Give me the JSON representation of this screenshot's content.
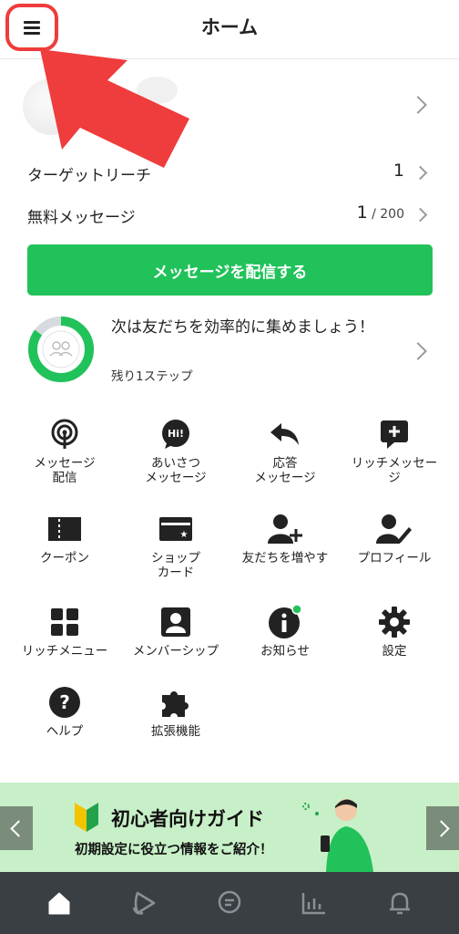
{
  "header": {
    "title": "ホーム"
  },
  "stats": [
    {
      "label": "ターゲットリーチ",
      "value": "1",
      "suffix": ""
    },
    {
      "label": "無料メッセージ",
      "value": "1",
      "suffix": " / 200"
    }
  ],
  "primary_button": "メッセージを配信する",
  "onboarding": {
    "text": "次は友だちを効率的に集めましょう！",
    "sub": "残り1ステップ",
    "progress_percent": 85
  },
  "menu": [
    {
      "label": "メッセージ\n配信",
      "icon": "broadcast-icon"
    },
    {
      "label": "あいさつ\nメッセージ",
      "icon": "hi-chat-icon"
    },
    {
      "label": "応答\nメッセージ",
      "icon": "reply-icon"
    },
    {
      "label": "リッチメッセー\nジ",
      "icon": "rich-message-icon"
    },
    {
      "label": "クーポン",
      "icon": "coupon-icon"
    },
    {
      "label": "ショップ\nカード",
      "icon": "shop-card-icon"
    },
    {
      "label": "友だちを増やす",
      "icon": "add-friend-icon"
    },
    {
      "label": "プロフィール",
      "icon": "profile-edit-icon"
    },
    {
      "label": "リッチメニュー",
      "icon": "rich-menu-icon"
    },
    {
      "label": "メンバーシップ",
      "icon": "membership-icon"
    },
    {
      "label": "お知らせ",
      "icon": "info-icon"
    },
    {
      "label": "設定",
      "icon": "gear-icon"
    },
    {
      "label": "ヘルプ",
      "icon": "help-icon"
    },
    {
      "label": "拡張機能",
      "icon": "puzzle-icon"
    }
  ],
  "banner": {
    "title": "初心者向けガイド",
    "subtitle": "初期設定に役立つ情報をご紹介！"
  },
  "tabs": [
    "home-icon",
    "timeline-icon",
    "chat-icon",
    "analytics-icon",
    "notification-icon"
  ],
  "colors": {
    "accent": "#22c25a",
    "highlight": "#ef3c3c",
    "tabbar": "#3a3f44",
    "banner": "#c8f0c8"
  }
}
